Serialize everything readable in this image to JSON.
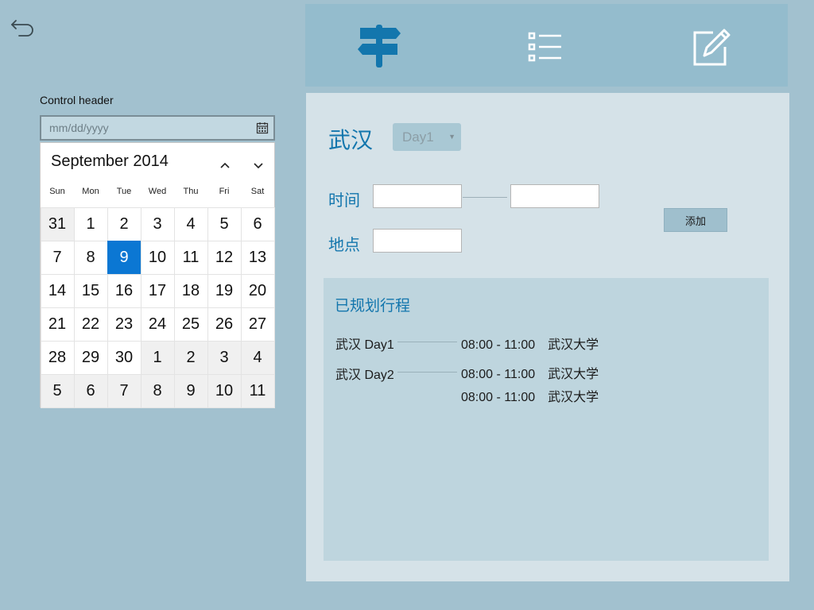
{
  "nav": {
    "back_icon": "back-arrow-icon"
  },
  "datepicker": {
    "header": "Control header",
    "placeholder": "mm/dd/yyyy",
    "month_label": "September 2014",
    "weekdays": [
      "Sun",
      "Mon",
      "Tue",
      "Wed",
      "Thu",
      "Fri",
      "Sat"
    ],
    "days": [
      {
        "d": "31",
        "other": true
      },
      {
        "d": "1"
      },
      {
        "d": "2"
      },
      {
        "d": "3"
      },
      {
        "d": "4"
      },
      {
        "d": "5"
      },
      {
        "d": "6"
      },
      {
        "d": "7"
      },
      {
        "d": "8"
      },
      {
        "d": "9",
        "selected": true
      },
      {
        "d": "10"
      },
      {
        "d": "11"
      },
      {
        "d": "12"
      },
      {
        "d": "13"
      },
      {
        "d": "14"
      },
      {
        "d": "15"
      },
      {
        "d": "16"
      },
      {
        "d": "17"
      },
      {
        "d": "18"
      },
      {
        "d": "19"
      },
      {
        "d": "20"
      },
      {
        "d": "21"
      },
      {
        "d": "22"
      },
      {
        "d": "23"
      },
      {
        "d": "24"
      },
      {
        "d": "25"
      },
      {
        "d": "26"
      },
      {
        "d": "27"
      },
      {
        "d": "28"
      },
      {
        "d": "29"
      },
      {
        "d": "30"
      },
      {
        "d": "1",
        "other": true
      },
      {
        "d": "2",
        "other": true
      },
      {
        "d": "3",
        "other": true
      },
      {
        "d": "4",
        "other": true
      },
      {
        "d": "5",
        "other": true
      },
      {
        "d": "6",
        "other": true
      },
      {
        "d": "7",
        "other": true
      },
      {
        "d": "8",
        "other": true
      },
      {
        "d": "9",
        "other": true
      },
      {
        "d": "10",
        "other": true
      },
      {
        "d": "11",
        "other": true
      }
    ],
    "selected_color": "#0b77d3"
  },
  "toolbar": {
    "icons": [
      "signpost-icon",
      "list-icon",
      "edit-icon"
    ],
    "accent": "#1376ad"
  },
  "planner": {
    "city": "武汉",
    "day_selected": "Day1",
    "time_label": "时间",
    "place_label": "地点",
    "add_label": "添加",
    "planned_title": "已规划行程",
    "trips": [
      {
        "label": "武汉 Day1",
        "segments": [
          {
            "time": "08:00 - 11:00",
            "place": "武汉大学"
          }
        ]
      },
      {
        "label": "武汉 Day2",
        "segments": [
          {
            "time": "08:00 - 11:00",
            "place": "武汉大学"
          },
          {
            "time": "08:00 - 11:00",
            "place": "武汉大学"
          }
        ]
      }
    ]
  }
}
